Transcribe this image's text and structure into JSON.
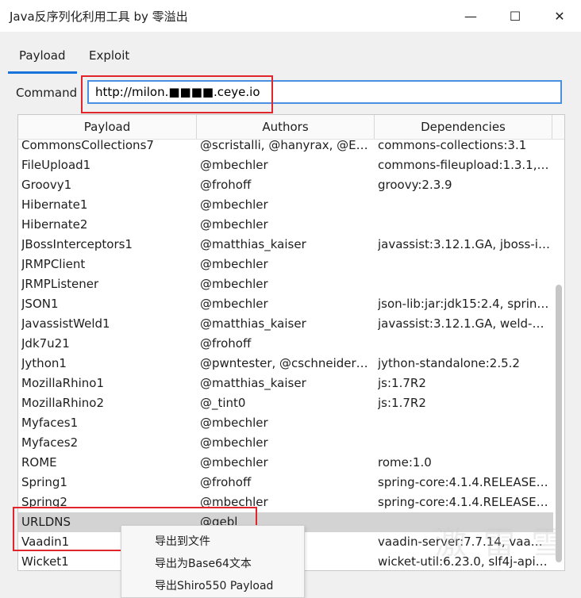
{
  "window": {
    "title": "Java反序列化利用工具 by 零溢出",
    "minimize_glyph": "—",
    "maximize_glyph": "☐",
    "close_glyph": "✕"
  },
  "tabs": [
    {
      "label": "Payload",
      "active": true
    },
    {
      "label": "Exploit",
      "active": false
    }
  ],
  "command": {
    "label": "Command",
    "value": "http://milon.■■■■.ceye.io"
  },
  "table": {
    "columns": [
      "Payload",
      "Authors",
      "Dependencies"
    ],
    "rows": [
      [
        "CommonsCollections7",
        "@scristalli, @hanyrax, @Edo…",
        "commons-collections:3.1"
      ],
      [
        "FileUpload1",
        "@mbechler",
        "commons-fileupload:1.3.1, c…"
      ],
      [
        "Groovy1",
        "@frohoff",
        "groovy:2.3.9"
      ],
      [
        "Hibernate1",
        "@mbechler",
        ""
      ],
      [
        "Hibernate2",
        "@mbechler",
        ""
      ],
      [
        "JBossInterceptors1",
        "@matthias_kaiser",
        "javassist:3.12.1.GA, jboss-int…"
      ],
      [
        "JRMPClient",
        "@mbechler",
        ""
      ],
      [
        "JRMPListener",
        "@mbechler",
        ""
      ],
      [
        "JSON1",
        "@mbechler",
        "json-lib:jar:jdk15:2.4, spring-…"
      ],
      [
        "JavassistWeld1",
        "@matthias_kaiser",
        "javassist:3.12.1.GA, weld-co…"
      ],
      [
        "Jdk7u21",
        "@frohoff",
        ""
      ],
      [
        "Jython1",
        "@pwntester, @cschneider4…",
        "jython-standalone:2.5.2"
      ],
      [
        "MozillaRhino1",
        "@matthias_kaiser",
        "js:1.7R2"
      ],
      [
        "MozillaRhino2",
        "@_tint0",
        "js:1.7R2"
      ],
      [
        "Myfaces1",
        "@mbechler",
        ""
      ],
      [
        "Myfaces2",
        "@mbechler",
        ""
      ],
      [
        "ROME",
        "@mbechler",
        "rome:1.0"
      ],
      [
        "Spring1",
        "@frohoff",
        "spring-core:4.1.4.RELEASE, s…"
      ],
      [
        "Spring2",
        "@mbechler",
        "spring-core:4.1.4.RELEASE, s…"
      ],
      [
        "URLDNS",
        "@gebl",
        ""
      ],
      [
        "Vaadin1",
        "",
        "vaadin-server:7.7.14, vaadin-…"
      ],
      [
        "Wicket1",
        "",
        "wicket-util:6.23.0, slf4j-api:1…"
      ]
    ],
    "selected_row": 19
  },
  "context_menu": {
    "items": [
      "导出到文件",
      "导出为Base64文本",
      "导出Shiro550 Payload"
    ]
  },
  "watermark": {
    "text": "激 雷 雪"
  },
  "colors": {
    "accent": "#1a73d9",
    "highlight_box": "#e0252b",
    "selected_row": "#d3d3d3"
  }
}
